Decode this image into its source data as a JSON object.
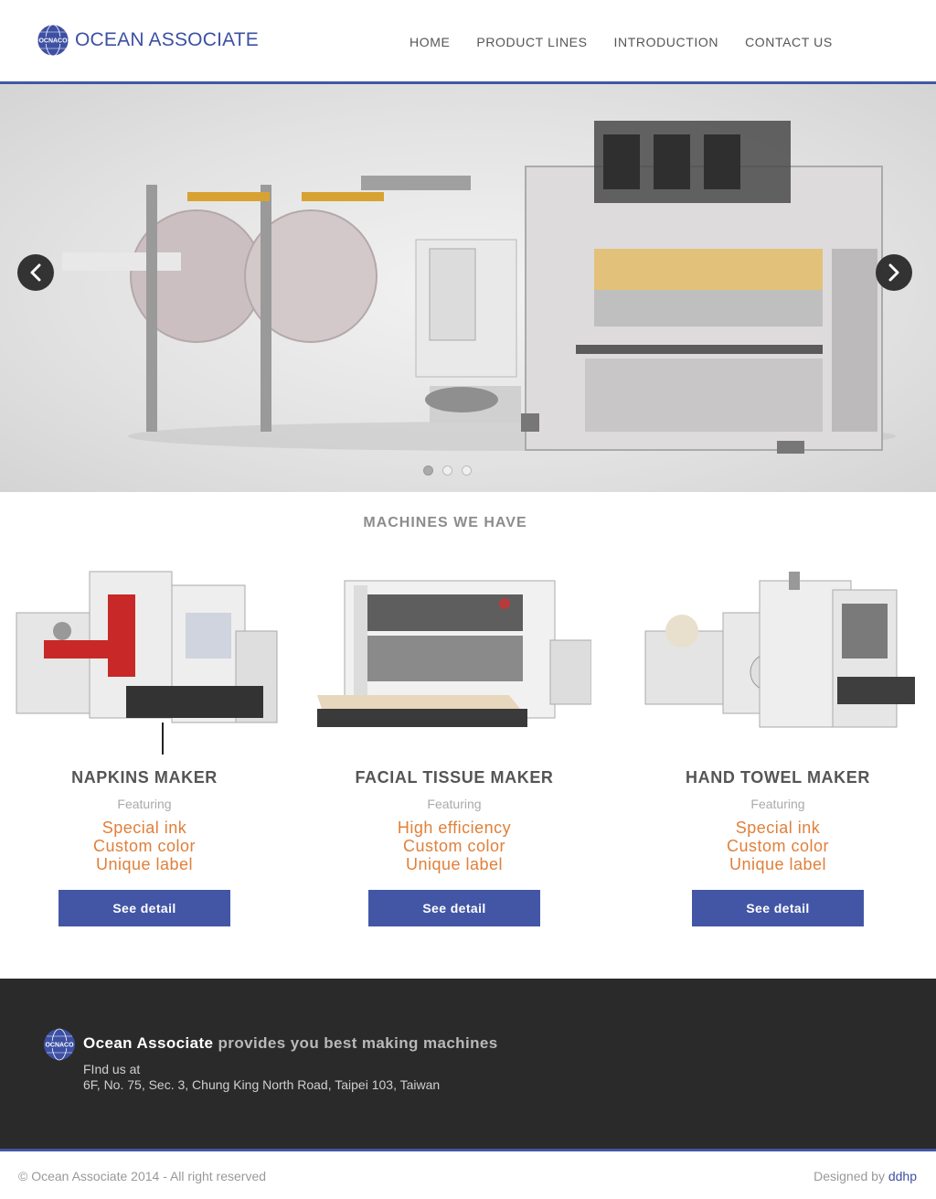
{
  "brand": {
    "name": "OCEAN ASSOCIATE",
    "logo_text": "OCNACO",
    "color": "#3d50a3"
  },
  "nav": {
    "items": [
      "HOME",
      "PRODUCT LINES",
      "INTRODUCTION",
      "CONTACT US"
    ]
  },
  "hero": {
    "slide_count": 3,
    "active_slide": 1,
    "prev_icon": "chevron-left-icon",
    "next_icon": "chevron-right-icon"
  },
  "machines": {
    "title": "MACHINES WE HAVE",
    "cards": [
      {
        "name": "NAPKINS MAKER",
        "featuring": "Featuring",
        "points": [
          "Special ink",
          "Custom color",
          "Unique label"
        ],
        "button": "See detail"
      },
      {
        "name": "FACIAL TISSUE MAKER",
        "featuring": "Featuring",
        "points": [
          "High efficiency",
          "Custom color",
          "Unique label"
        ],
        "button": "See detail"
      },
      {
        "name": "HAND TOWEL MAKER",
        "featuring": "Featuring",
        "points": [
          "Special ink",
          "Custom color",
          "Unique label"
        ],
        "button": "See detail"
      }
    ]
  },
  "footer": {
    "company": "Ocean Associate",
    "tagline": "provides you best making machines",
    "find_label": "FInd us at",
    "address": "6F, No. 75, Sec. 3, Chung King North Road, Taipei 103, Taiwan",
    "copyright": "© Ocean Associate 2014 - All right reserved",
    "designed_by": "Designed by",
    "designer": "ddhp"
  },
  "colors": {
    "accent": "#4356a6",
    "highlight": "#e0803a",
    "footer_bg": "#2a2a2a"
  }
}
